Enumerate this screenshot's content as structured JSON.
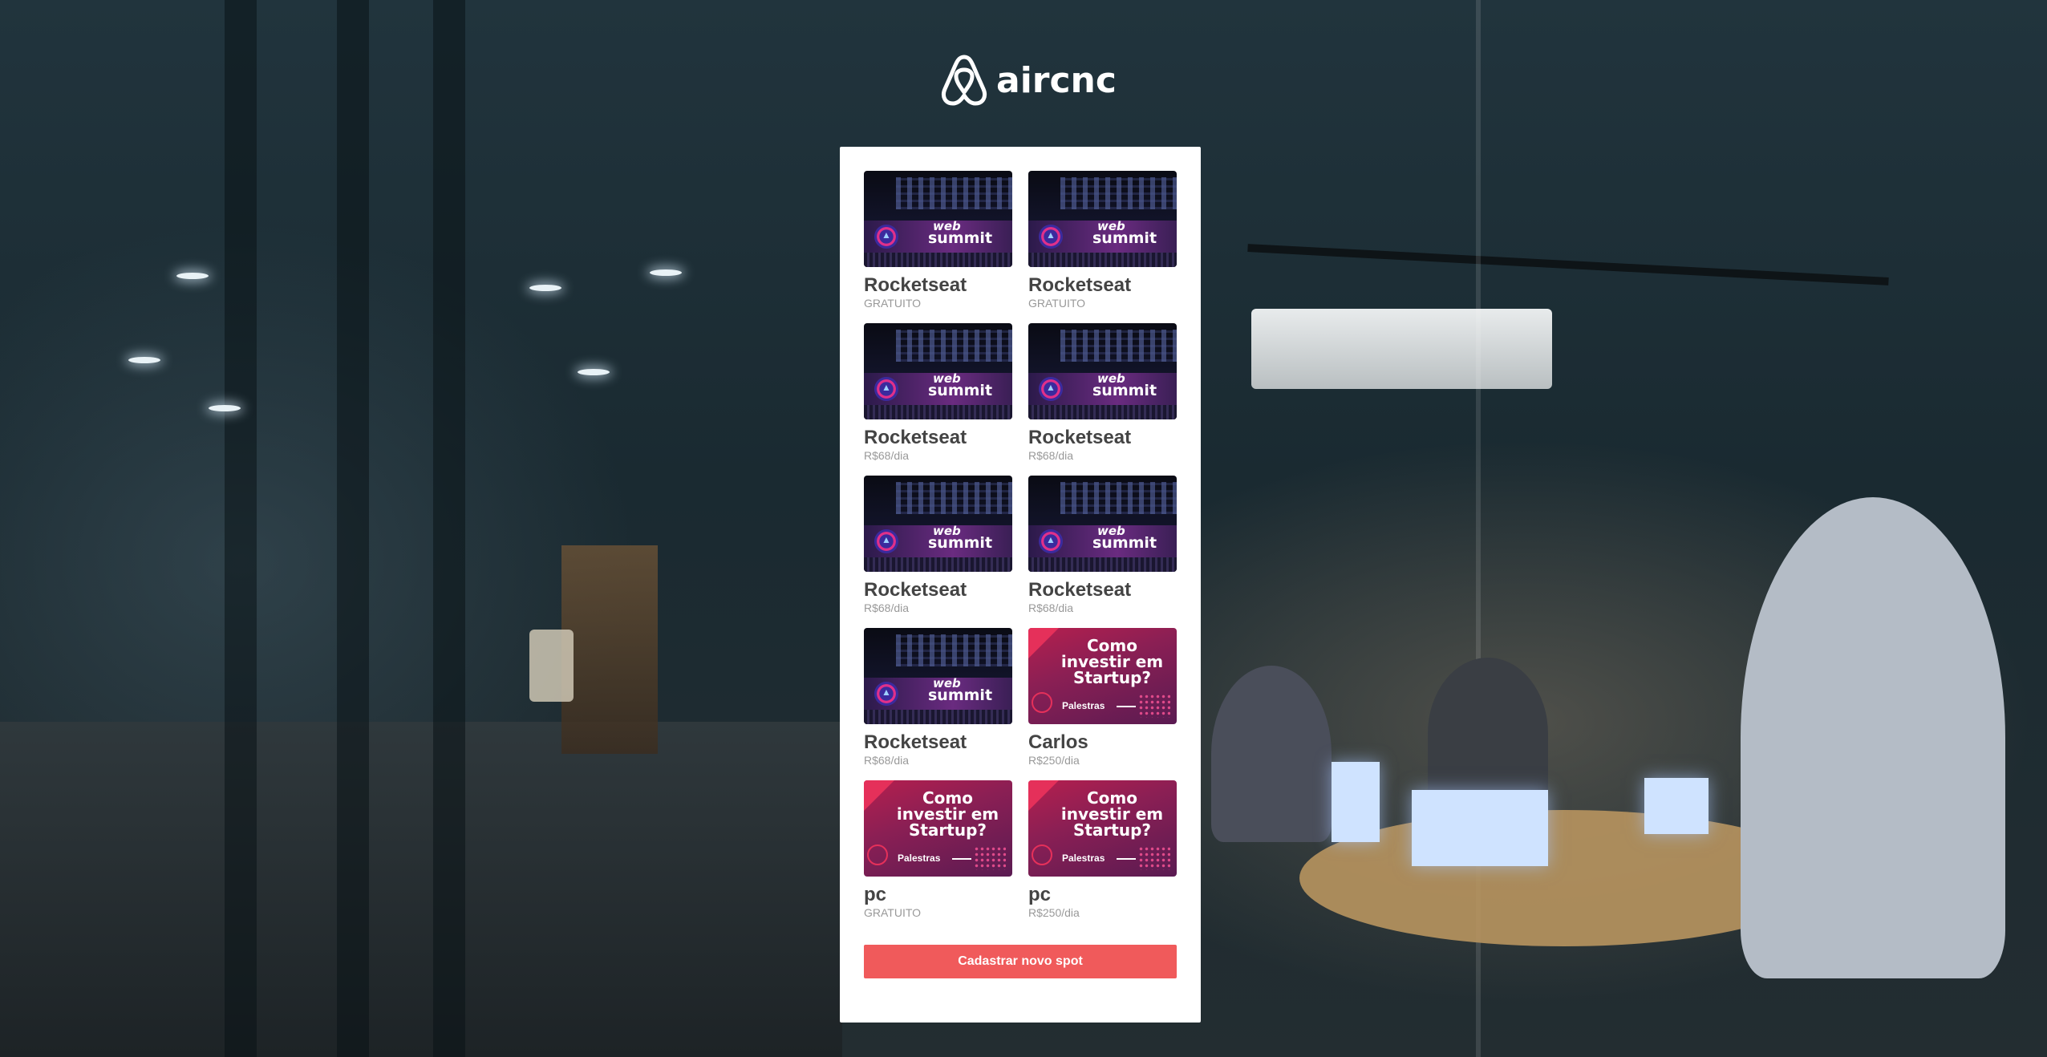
{
  "brand": {
    "name": "aircnc",
    "icon": "airbnb-logo-icon"
  },
  "spots": [
    {
      "company": "Rocketseat",
      "price": "GRATUITO",
      "image": "websummit"
    },
    {
      "company": "Rocketseat",
      "price": "GRATUITO",
      "image": "websummit"
    },
    {
      "company": "Rocketseat",
      "price": "R$68/dia",
      "image": "websummit"
    },
    {
      "company": "Rocketseat",
      "price": "R$68/dia",
      "image": "websummit"
    },
    {
      "company": "Rocketseat",
      "price": "R$68/dia",
      "image": "websummit"
    },
    {
      "company": "Rocketseat",
      "price": "R$68/dia",
      "image": "websummit"
    },
    {
      "company": "Rocketseat",
      "price": "R$68/dia",
      "image": "websummit"
    },
    {
      "company": "Carlos",
      "price": "R$250/dia",
      "image": "startup"
    },
    {
      "company": "pc",
      "price": "GRATUITO",
      "image": "startup"
    },
    {
      "company": "pc",
      "price": "R$250/dia",
      "image": "startup"
    }
  ],
  "images": {
    "websummit": {
      "line1": "web",
      "line2": "summit"
    },
    "startup": {
      "headline": "Como investir em Startup?",
      "tag": "Palestras"
    }
  },
  "actions": {
    "new_spot_label": "Cadastrar novo spot"
  },
  "colors": {
    "accent": "#f05a5b",
    "panel": "#ffffff",
    "title": "#444444",
    "muted": "#999999"
  }
}
